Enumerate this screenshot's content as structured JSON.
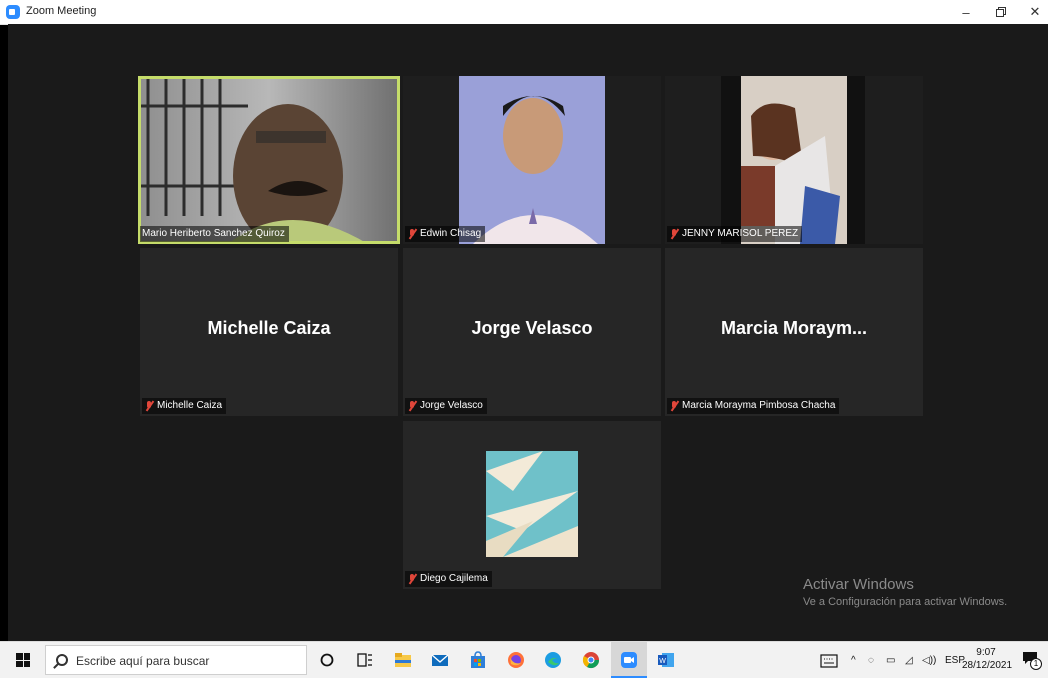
{
  "window": {
    "title": "Zoom Meeting"
  },
  "participants": [
    {
      "tag": "Mario Heriberto Sanchez Quiroz",
      "muted": false,
      "active": true,
      "video": true
    },
    {
      "tag": "Edwin Chisag",
      "muted": true,
      "video": true
    },
    {
      "tag": "JENNY MARISOL PEREZ",
      "muted": true,
      "video": true
    },
    {
      "tag": "Michelle Caiza",
      "display": "Michelle Caiza",
      "muted": true,
      "video": false
    },
    {
      "tag": "Jorge Velasco",
      "display": "Jorge Velasco",
      "muted": true,
      "video": false
    },
    {
      "tag": "Marcia Morayma Pimbosa Chacha",
      "display": "Marcia  Moraym...",
      "muted": true,
      "video": false
    },
    {
      "tag": "Diego Cajilema",
      "muted": true,
      "video": true
    }
  ],
  "watermark": {
    "line1": "Activar Windows",
    "line2": "Ve a Configuración para activar Windows."
  },
  "taskbar": {
    "search_placeholder": "Escribe aquí para buscar",
    "language": "ESP",
    "time": "9:07",
    "date": "28/12/2021",
    "notification_count": "1"
  },
  "colors": {
    "active_speaker_border": "#c5dc6a",
    "muted_icon": "#e0463a",
    "zoom_blue": "#2d8cff"
  }
}
